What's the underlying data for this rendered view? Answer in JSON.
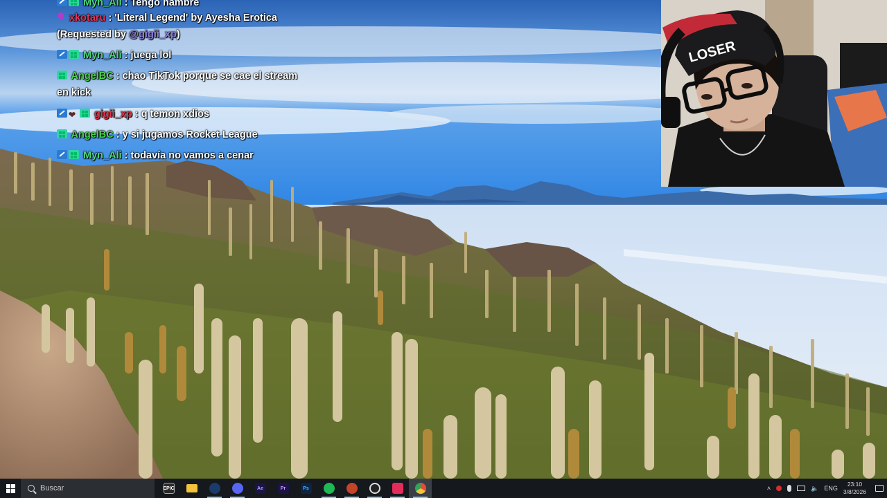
{
  "chat": {
    "messages": [
      {
        "badges": [
          "mod",
          "sub"
        ],
        "user": "Myn_Ali",
        "user_color": "#4fd67a",
        "text": ": Tengo hambre"
      },
      {
        "badges": [
          "mic"
        ],
        "user": "xkotaru",
        "user_color": "#e0355a",
        "text": ": 'Literal Legend' by Ayesha Erotica",
        "text2": "(Requested by ",
        "mention": "@gigii_xp",
        "text3": ")"
      },
      {
        "badges": [
          "mod",
          "sub"
        ],
        "user": "Myn_Ali",
        "user_color": "#4fd67a",
        "text": ": juega lol"
      },
      {
        "badges": [
          "sub"
        ],
        "user": "AngelBC",
        "user_color": "#4bd44b",
        "text": ": chao TikTok porque se cae el stream",
        "text2": "en kick"
      },
      {
        "badges": [
          "mod",
          "heart",
          "sub"
        ],
        "user": "gigii_xp",
        "user_color": "#e0344a",
        "text": ": q temon xdios"
      },
      {
        "badges": [
          "sub"
        ],
        "user": "AngelBC",
        "user_color": "#4bd44b",
        "text": ": y si jugamos Rocket League"
      },
      {
        "badges": [
          "mod",
          "sub"
        ],
        "user": "Myn_Ali",
        "user_color": "#4fd67a",
        "text": ": todavía no vamos a cenar"
      }
    ]
  },
  "webcam": {
    "beanie_text": "LOSER"
  },
  "taskbar": {
    "search_placeholder": "Buscar",
    "apps": [
      {
        "name": "epic-games-icon",
        "label": "EPIC",
        "color": "#2a2a2a"
      },
      {
        "name": "file-explorer-icon",
        "label": "",
        "color": "#f3c33b"
      },
      {
        "name": "steam-icon",
        "label": "",
        "color": "#1b3b6a"
      },
      {
        "name": "discord-icon",
        "label": "",
        "color": "#5865f2"
      },
      {
        "name": "after-effects-icon",
        "label": "Ae",
        "color": "#1b1446"
      },
      {
        "name": "premiere-icon",
        "label": "Pr",
        "color": "#1b1446"
      },
      {
        "name": "photoshop-icon",
        "label": "Ps",
        "color": "#0c2444"
      },
      {
        "name": "spotify-icon",
        "label": "",
        "color": "#1db954"
      },
      {
        "name": "clipchamp-icon",
        "label": "",
        "color": "#c2452a"
      },
      {
        "name": "obs-icon",
        "label": "",
        "color": "#222"
      },
      {
        "name": "tiktok-icon",
        "label": "",
        "color": "#e22c5b"
      },
      {
        "name": "chrome-icon",
        "label": "",
        "color": "#e8a21c"
      }
    ],
    "tray_language": "ENG",
    "time": "23:10",
    "date": "3/8/2026"
  }
}
